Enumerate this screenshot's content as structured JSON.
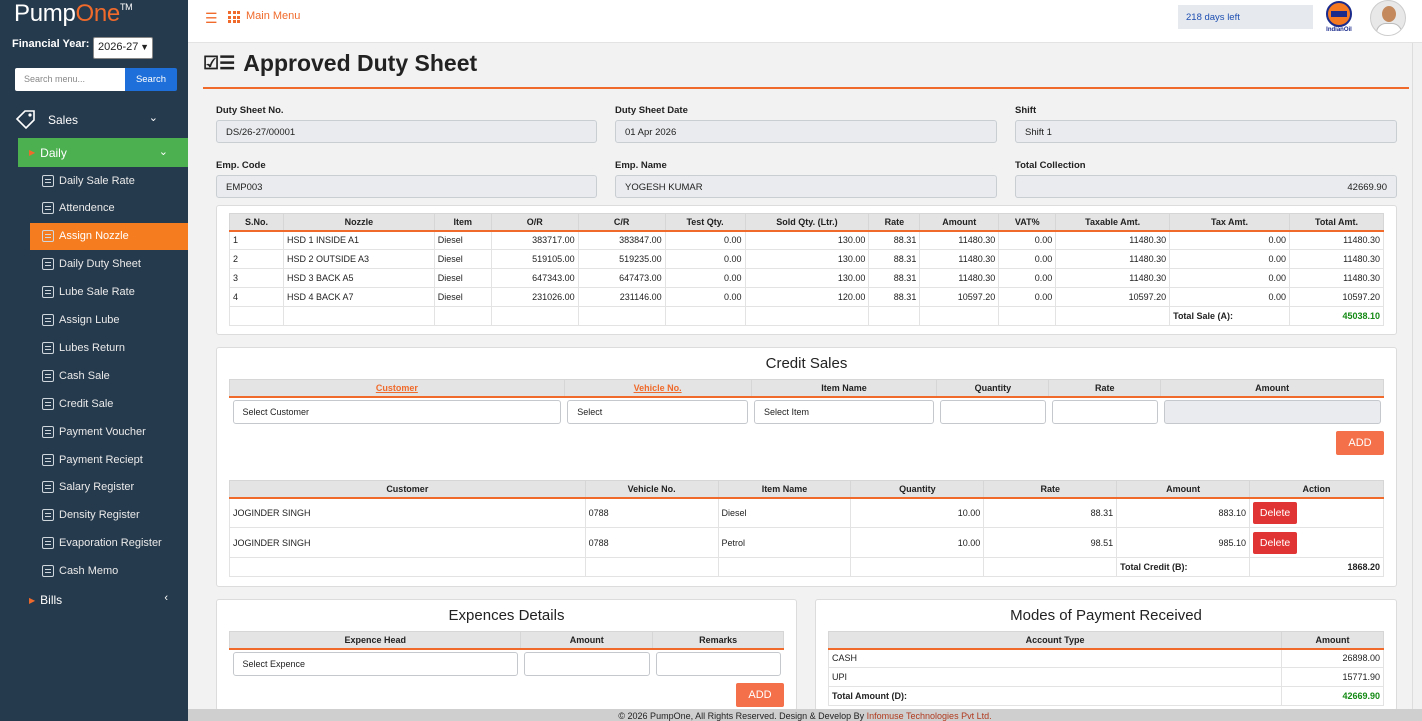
{
  "brand": {
    "name_a": "Pump",
    "name_b": "One",
    "tm": "TM"
  },
  "sidebar": {
    "fy_label": "Financial Year:",
    "fy_value": "2026-27",
    "search_placeholder": "Search menu...",
    "search_button": "Search",
    "sales": "Sales",
    "daily": "Daily",
    "items": [
      "Daily Sale Rate",
      "Attendence",
      "Assign Nozzle",
      "Daily Duty Sheet",
      "Lube Sale Rate",
      "Assign Lube",
      "Lubes Return",
      "Cash Sale",
      "Credit Sale",
      "Payment Voucher",
      "Payment Reciept",
      "Salary Register",
      "Density Register",
      "Evaporation Register",
      "Cash Memo"
    ],
    "active_item": "Assign Nozzle",
    "bills": "Bills"
  },
  "topbar": {
    "main_menu": "Main Menu",
    "days_left": "218 days left",
    "company_logo_text": "IndianOil"
  },
  "page": {
    "title": "Approved Duty Sheet"
  },
  "form": {
    "duty_sheet_no_label": "Duty Sheet No.",
    "duty_sheet_no": "DS/26-27/00001",
    "date_label": "Duty Sheet Date",
    "date": "01 Apr 2026",
    "shift_label": "Shift",
    "shift": "Shift 1",
    "emp_code_label": "Emp. Code",
    "emp_code": "EMP003",
    "emp_name_label": "Emp. Name",
    "emp_name": "YOGESH KUMAR",
    "total_collection_label": "Total Collection",
    "total_collection": "42669.90"
  },
  "nozzle_table": {
    "headers": [
      "S.No.",
      "Nozzle",
      "Item",
      "O/R",
      "C/R",
      "Test Qty.",
      "Sold Qty. (Ltr.)",
      "Rate",
      "Amount",
      "VAT%",
      "Taxable Amt.",
      "Tax Amt.",
      "Total Amt."
    ],
    "rows": [
      [
        "1",
        "HSD 1 INSIDE A1",
        "Diesel",
        "383717.00",
        "383847.00",
        "0.00",
        "130.00",
        "88.31",
        "11480.30",
        "0.00",
        "11480.30",
        "0.00",
        "11480.30"
      ],
      [
        "2",
        "HSD 2 OUTSIDE A3",
        "Diesel",
        "519105.00",
        "519235.00",
        "0.00",
        "130.00",
        "88.31",
        "11480.30",
        "0.00",
        "11480.30",
        "0.00",
        "11480.30"
      ],
      [
        "3",
        "HSD 3 BACK A5",
        "Diesel",
        "647343.00",
        "647473.00",
        "0.00",
        "130.00",
        "88.31",
        "11480.30",
        "0.00",
        "11480.30",
        "0.00",
        "11480.30"
      ],
      [
        "4",
        "HSD 4 BACK A7",
        "Diesel",
        "231026.00",
        "231146.00",
        "0.00",
        "120.00",
        "88.31",
        "10597.20",
        "0.00",
        "10597.20",
        "0.00",
        "10597.20"
      ]
    ],
    "total_label": "Total Sale (A):",
    "total": "45038.10"
  },
  "credit_sales": {
    "title": "Credit Sales",
    "entry_headers": [
      "Customer",
      "Vehicle No.",
      "Item Name",
      "Quantity",
      "Rate",
      "Amount"
    ],
    "customer_placeholder": "Select Customer",
    "vehicle_placeholder": "Select",
    "item_placeholder": "Select Item",
    "add": "ADD",
    "list_headers": [
      "Customer",
      "Vehicle No.",
      "Item Name",
      "Quantity",
      "Rate",
      "Amount",
      "Action"
    ],
    "rows": [
      [
        "JOGINDER SINGH",
        "0788",
        "Diesel",
        "10.00",
        "88.31",
        "883.10"
      ],
      [
        "JOGINDER SINGH",
        "0788",
        "Petrol",
        "10.00",
        "98.51",
        "985.10"
      ]
    ],
    "delete": "Delete",
    "total_label": "Total Credit (B):",
    "total": "1868.20"
  },
  "expences": {
    "title": "Expences Details",
    "headers": [
      "Expence Head",
      "Amount",
      "Remarks"
    ],
    "placeholder": "Select Expence",
    "add": "ADD"
  },
  "payments": {
    "title": "Modes of Payment Received",
    "headers": [
      "Account Type",
      "Amount"
    ],
    "rows": [
      [
        "CASH",
        "26898.00"
      ],
      [
        "UPI",
        "15771.90"
      ]
    ],
    "total_label": "Total Amount (D):",
    "total": "42669.90"
  },
  "footer": {
    "text": "© 2026 PumpOne, All Rights Reserved. Design & Develop By ",
    "company": "Infomuse Technologies Pvt Ltd."
  }
}
